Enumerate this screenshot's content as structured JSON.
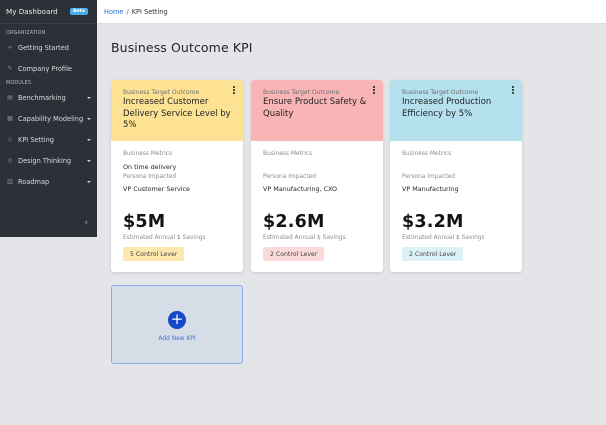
{
  "sidebar": {
    "title": "My Dashboard",
    "badge": "Beta",
    "section_org": "ORGANIZATION",
    "section_modules": "MODULES",
    "org_items": [
      {
        "label": "Getting Started",
        "icon": "rocket-icon"
      },
      {
        "label": "Company Profile",
        "icon": "pencil-icon"
      }
    ],
    "module_items": [
      {
        "label": "Benchmarking",
        "icon": "chart-icon"
      },
      {
        "label": "Capability Modeling",
        "icon": "grid-icon"
      },
      {
        "label": "KPI Setting",
        "icon": "tag-icon"
      },
      {
        "label": "Design Thinking",
        "icon": "bulb-icon"
      },
      {
        "label": "Roadmap",
        "icon": "map-icon"
      }
    ],
    "collapse": "‹"
  },
  "breadcrumb": {
    "home": "Home",
    "separator": "/",
    "current": "KPI Setting"
  },
  "page_title": "Business Outcome KPI",
  "cards": [
    {
      "kind": "Business Target Outcome",
      "title": "Increased Customer Delivery Service Level by 5%",
      "color": "#fde293",
      "metrics_label": "Business Metrics",
      "metrics_value": "On time delivery",
      "persona_label": "Persona Impacted",
      "persona_value": "VP Customer Service",
      "savings": "$5M",
      "savings_label": "Estimated Annual $ Savings",
      "lever": "5 Control Lever",
      "lever_color": "#fde8b0"
    },
    {
      "kind": "Business Target Outcome",
      "title": "Ensure Product Safety & Quality",
      "color": "#f9b5b5",
      "metrics_label": "Business Metrics",
      "metrics_value": "",
      "persona_label": "Persona Impacted",
      "persona_value": "VP Manufacturing, CXO",
      "savings": "$2.6M",
      "savings_label": "Estimated Annual $ Savings",
      "lever": "2 Control Lever",
      "lever_color": "#fbdada"
    },
    {
      "kind": "Business Target Outcome",
      "title": "Increased Production Efficiency by 5%",
      "color": "#b5e0ee",
      "metrics_label": "Business Metrics",
      "metrics_value": "",
      "persona_label": "Persona Impacted",
      "persona_value": "VP Manufacturing",
      "savings": "$3.2M",
      "savings_label": "Estimated Annual $ Savings",
      "lever": "2 Control Lever",
      "lever_color": "#dcf0f8"
    }
  ],
  "add_kpi": {
    "label": "Add New KPI",
    "icon": "plus-icon"
  }
}
